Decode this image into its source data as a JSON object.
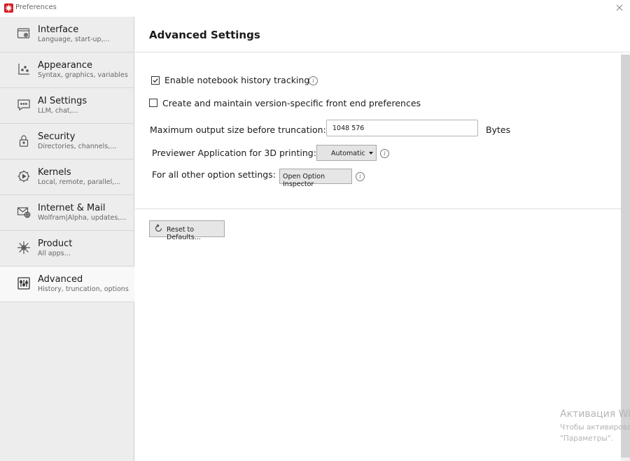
{
  "window": {
    "title": "Preferences",
    "icon": "wolfram-spikey-icon"
  },
  "sidebar": {
    "items": [
      {
        "label": "Interface",
        "sub": "Language, start-up,...",
        "icon": "window-gear-icon"
      },
      {
        "label": "Appearance",
        "sub": "Syntax, graphics, variables",
        "icon": "chart-icon"
      },
      {
        "label": "AI Settings",
        "sub": "LLM, chat,...",
        "icon": "chat-bubble-icon"
      },
      {
        "label": "Security",
        "sub": "Directories, channels,...",
        "icon": "lock-icon"
      },
      {
        "label": "Kernels",
        "sub": "Local, remote, parallel,...",
        "icon": "gear-play-icon"
      },
      {
        "label": "Internet & Mail",
        "sub": "Wolfram|Alpha, updates,...",
        "icon": "mail-globe-icon"
      },
      {
        "label": "Product",
        "sub": "All apps...",
        "icon": "snowflake-icon"
      },
      {
        "label": "Advanced",
        "sub": "History, truncation, options",
        "icon": "sliders-icon",
        "active": true
      }
    ]
  },
  "main": {
    "heading": "Advanced Settings",
    "history": {
      "label": "Enable notebook history tracking",
      "checked": true
    },
    "version_prefs": {
      "label": "Create and maintain version-specific front end preferences",
      "checked": false
    },
    "max_output": {
      "label": "Maximum output size before truncation:",
      "value": "1048 576",
      "unit": "Bytes"
    },
    "previewer": {
      "label": "Previewer Application for 3D printing:",
      "selected": "Automatic"
    },
    "other_options": {
      "label": "For all other option settings:",
      "button": "Open Option Inspector"
    },
    "reset_button": "Reset to Defaults..."
  },
  "watermark": {
    "line1": "Активация Wi",
    "line2": "Чтобы активироват",
    "line3": "\"Параметры\"."
  }
}
